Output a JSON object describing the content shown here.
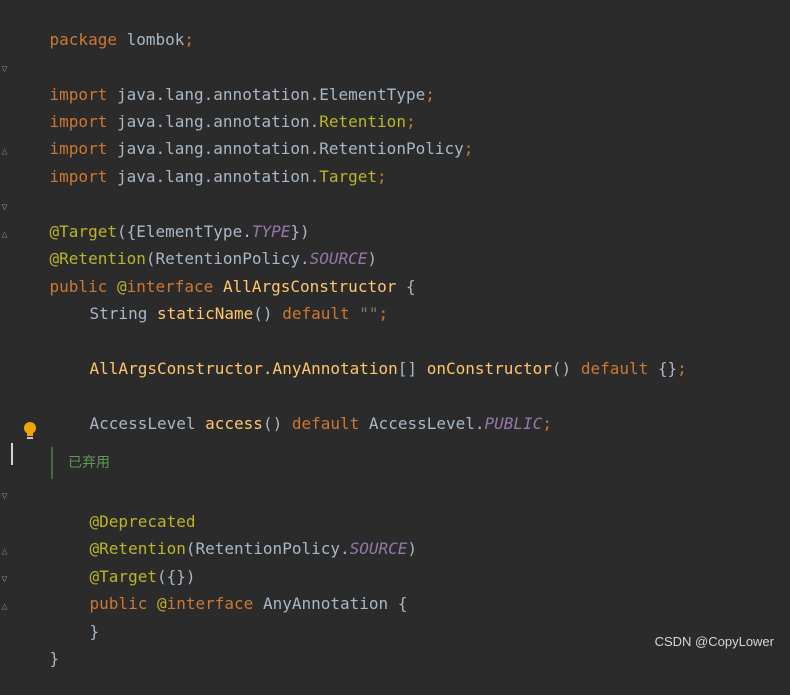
{
  "code": {
    "line1": {
      "kw": "package",
      "rest": " lombok",
      "semi": ";"
    },
    "imports": [
      {
        "kw": "import",
        "pkg": " java.lang.annotation.",
        "cls": "ElementType",
        "semi": ";"
      },
      {
        "kw": "import",
        "pkg": " java.lang.annotation.",
        "cls": "Retention",
        "semi": ";"
      },
      {
        "kw": "import",
        "pkg": " java.lang.annotation.",
        "cls": "RetentionPolicy",
        "semi": ";"
      },
      {
        "kw": "import",
        "pkg": " java.lang.annotation.",
        "cls": "Target",
        "semi": ";"
      }
    ],
    "target_ann": {
      "ann": "@Target",
      "open": "({ElementType.",
      "const": "TYPE",
      "close": "})"
    },
    "retention_ann": {
      "ann": "@Retention",
      "open": "(RetentionPolicy.",
      "const": "SOURCE",
      "close": ")"
    },
    "decl": {
      "kw1": "public",
      "sp1": " ",
      "at": "@",
      "kw2": "interface",
      "sp2": " ",
      "name": "AllArgsConstructor",
      "open": " {"
    },
    "static_name": {
      "type": "String",
      "sp": " ",
      "fn": "staticName",
      "paren": "()",
      "sp2": " ",
      "kw": "default",
      "sp3": " ",
      "str": "\"\"",
      "semi": ";"
    },
    "on_constructor": {
      "type": "AllArgsConstructor.AnyAnnotation",
      "arr": "[]",
      "sp": " ",
      "fn": "onConstructor",
      "paren": "()",
      "sp2": " ",
      "kw": "default",
      "body": " {}",
      "semi": ";"
    },
    "access": {
      "type": "AccessLevel",
      "sp": " ",
      "fn": "access",
      "paren": "()",
      "sp2": " ",
      "kw": "default",
      "sp3": " ",
      "cls": "AccessLevel.",
      "const": "PUBLIC",
      "semi": ";"
    },
    "doc_text": "已弃用",
    "deprecated": "@Deprecated",
    "inner_retention": {
      "ann": "@Retention",
      "open": "(RetentionPolicy.",
      "const": "SOURCE",
      "close": ")"
    },
    "inner_target": {
      "ann": "@Target",
      "body": "({})"
    },
    "inner_decl": {
      "kw1": "public",
      "sp1": " ",
      "at": "@",
      "kw2": "interface",
      "sp2": " ",
      "name": "AnyAnnotation",
      "open": " {"
    },
    "inner_close": "}",
    "outer_close": "}"
  },
  "watermark": "CSDN @CopyLower",
  "icons": {
    "bulb": "lightbulb-icon",
    "fold": "fold-marker-icon"
  },
  "colors": {
    "background": "#2b2b2b",
    "keyword": "#cc7832",
    "annotation": "#bbb529",
    "method": "#ffc66d",
    "constant": "#9876aa",
    "string": "#6a8759",
    "text": "#a9b7c6",
    "doc": "#629755"
  }
}
